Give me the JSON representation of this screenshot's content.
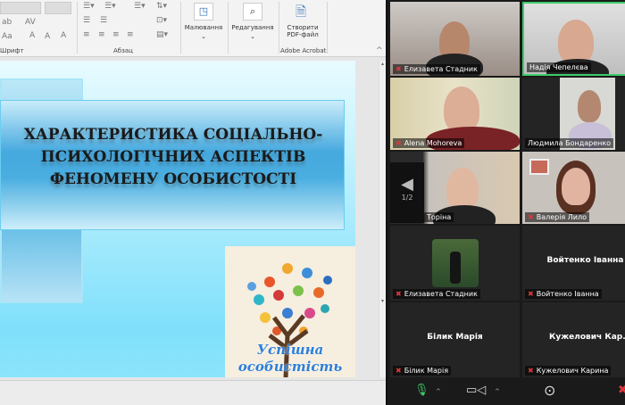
{
  "ribbon": {
    "groups": [
      {
        "label": "Шрифт"
      },
      {
        "label": "Абзац"
      },
      {
        "label": "Adobe Acrobat"
      }
    ],
    "buttons": {
      "drawing": "Малювання",
      "editing": "Редагування",
      "create_pdf": "Створити PDF-файл"
    },
    "font_controls": {
      "strike": "ab",
      "spacing": "AV",
      "case": "Aa",
      "grow": "A",
      "shrink": "A"
    }
  },
  "slide": {
    "title": "ХАРАКТЕРИСТИКА СОЦІАЛЬНО-ПСИХОЛОГІЧНИХ АСПЕКТІВ ФЕНОМЕНУ ОСОБИСТОСТІ",
    "logo_text": "Успішна особистість"
  },
  "zoom": {
    "accent": "#3ecb6a",
    "mute_color": "#e0363a",
    "page": "1/2",
    "participants": [
      {
        "name": "Елизавета Стадник",
        "video": true
      },
      {
        "name": "Надія Чепелєва",
        "video": true,
        "active": true
      },
      {
        "name": "Alena Mohoreva",
        "video": true
      },
      {
        "name": "Людмила Бондаренко",
        "video": true
      },
      {
        "name": "Ірина Торіна",
        "video": true
      },
      {
        "name": "Валерія Лило",
        "video": true
      },
      {
        "name": "Елизавета Стадник",
        "avatar": true
      },
      {
        "name": "Войтенко Іванна",
        "display": "Войтенко Іванна"
      },
      {
        "name": "Білик Марія",
        "display": "Білик Марія"
      },
      {
        "name": "Кужелович Карина",
        "display": "Кужелович  Кар..."
      }
    ],
    "toolbar": [
      "microphone-icon",
      "video-camera-icon",
      "more-icon",
      "end-icon"
    ]
  }
}
